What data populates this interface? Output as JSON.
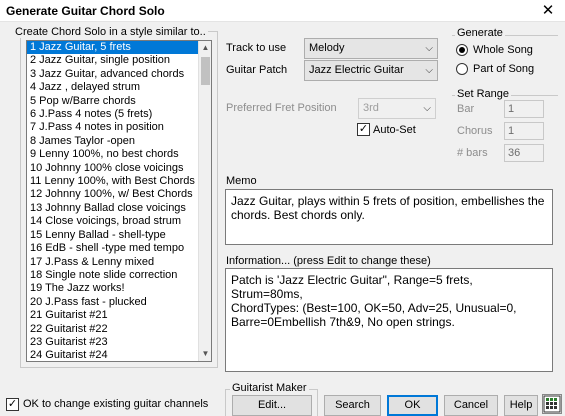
{
  "window": {
    "title": "Generate Guitar Chord Solo",
    "close_glyph": "✕"
  },
  "style_group": {
    "legend": "Create Chord Solo in a style similar to.."
  },
  "styles": [
    "1 Jazz Guitar, 5 frets",
    "2 Jazz Guitar, single position",
    "3 Jazz Guitar, advanced chords",
    "4 Jazz , delayed strum",
    "5 Pop w/Barre chords",
    "6 J.Pass 4 notes (5 frets)",
    "7 J.Pass 4 notes in position",
    "8 James Taylor -open",
    "9 Lenny 100%, no best chords",
    "10 Johnny 100% close voicings",
    "11 Lenny 100%, with Best Chords",
    "12 Johnny 100%, w/ Best Chords",
    "13 Johnny Ballad close voicings",
    "14 Close voicings, broad strum",
    "15 Lenny Ballad - shell-type",
    "16 EdB - shell -type med tempo",
    "17 J.Pass & Lenny mixed",
    "18 Single note slide correction",
    "19 The Jazz works!",
    "20 J.Pass fast - plucked",
    "21 Guitarist #21",
    "22 Guitarist #22",
    "23 Guitarist #23",
    "24 Guitarist #24"
  ],
  "selected_style_index": 0,
  "ok_change_channels": {
    "label": "OK to change existing guitar channels",
    "checked": true
  },
  "track": {
    "label": "Track to use",
    "value": "Melody"
  },
  "patch": {
    "label": "Guitar Patch",
    "value": "Jazz Electric Guitar"
  },
  "fret": {
    "label": "Preferred Fret Position",
    "value": "3rd"
  },
  "autoset": {
    "label": "Auto-Set",
    "checked": true
  },
  "generate": {
    "legend": "Generate",
    "options": [
      "Whole Song",
      "Part of Song"
    ],
    "selected": "Whole Song"
  },
  "set_range": {
    "legend": "Set Range",
    "bar_label": "Bar",
    "bar_value": "1",
    "chorus_label": "Chorus",
    "chorus_value": "1",
    "bars_label": "# bars",
    "bars_value": "36"
  },
  "memo": {
    "label": "Memo",
    "text": "Jazz Guitar, plays within 5 frets of position, embellishes the chords. Best chords only."
  },
  "information": {
    "label": "Information... (press Edit to change these)",
    "text": "Patch is 'Jazz Electric Guitar\", Range=5 frets,\nStrum=80ms,\nChordTypes: (Best=100, OK=50, Adv=25, Unusual=0,\nBarre=0Embellish 7th&9, No open strings."
  },
  "guitarist_maker": {
    "legend": "Guitarist Maker",
    "edit_label": "Edit..."
  },
  "buttons": {
    "search": "Search",
    "ok": "OK",
    "cancel": "Cancel",
    "help": "Help"
  },
  "icons": {
    "close": "close-icon",
    "dropdown": "chevron-down-icon",
    "scroll_up": "scroll-up-arrow-icon",
    "scroll_down": "scroll-down-arrow-icon",
    "grid": "grid-app-icon"
  },
  "colors": {
    "selection": "#0078d7",
    "default_button_border": "#0078d7"
  }
}
